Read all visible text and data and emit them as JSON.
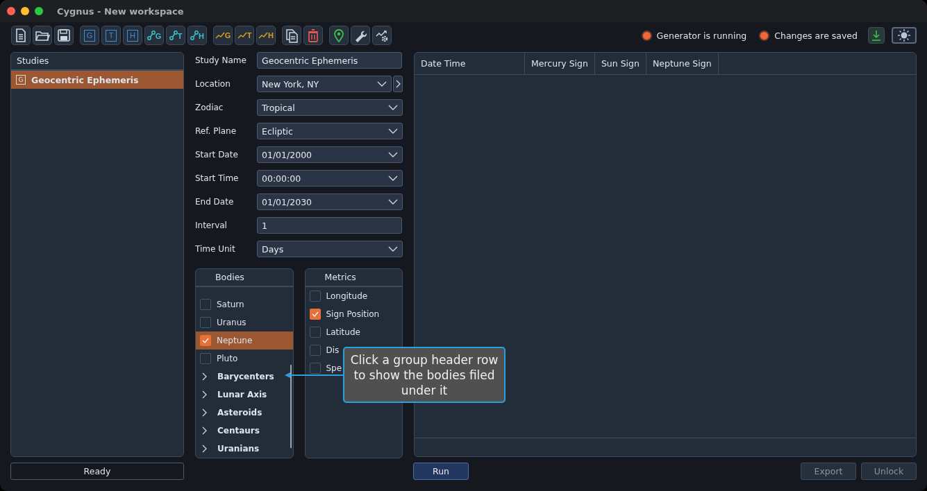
{
  "window": {
    "title": "Cygnus - New workspace"
  },
  "toolbar": [
    [
      {
        "kind": "new"
      },
      {
        "kind": "open"
      },
      {
        "kind": "save"
      }
    ],
    [
      {
        "kind": "boxed",
        "letter": "G"
      },
      {
        "kind": "boxed",
        "letter": "T"
      },
      {
        "kind": "boxed",
        "letter": "H"
      },
      {
        "kind": "nodes",
        "letter": "G"
      },
      {
        "kind": "nodes",
        "letter": "T"
      },
      {
        "kind": "nodes",
        "letter": "H"
      }
    ],
    [
      {
        "kind": "trend",
        "letter": "G"
      },
      {
        "kind": "trend",
        "letter": "T"
      },
      {
        "kind": "trend",
        "letter": "H"
      }
    ],
    [
      {
        "kind": "copy"
      },
      {
        "kind": "delete"
      }
    ],
    [
      {
        "kind": "pin"
      },
      {
        "kind": "wrench"
      },
      {
        "kind": "trend-gear"
      }
    ]
  ],
  "theme_button": {
    "on": true
  },
  "indicators": [
    {
      "label": "Generator is running",
      "on": true
    },
    {
      "label": "Changes are saved",
      "on": true
    }
  ],
  "studies": {
    "title": "Studies",
    "items": [
      {
        "badge": "G",
        "label": "Geocentric Ephemeris",
        "selected": true
      }
    ]
  },
  "form": [
    {
      "label": "Study Name",
      "kind": "text",
      "value": "Geocentric Ephemeris"
    },
    {
      "label": "Location",
      "kind": "dropdown",
      "value": "New York, NY",
      "extra": true
    },
    {
      "label": "Zodiac",
      "kind": "dropdown",
      "value": "Tropical"
    },
    {
      "label": "Ref. Plane",
      "kind": "dropdown",
      "value": "Ecliptic"
    },
    {
      "label": "Start Date",
      "kind": "dropdown",
      "value": "01/01/2000"
    },
    {
      "label": "Start Time",
      "kind": "dropdown",
      "value": "00:00:00"
    },
    {
      "label": "End Date",
      "kind": "dropdown",
      "value": "01/01/2030"
    },
    {
      "label": "Interval",
      "kind": "text",
      "value": "1"
    },
    {
      "label": "Time Unit",
      "kind": "dropdown",
      "value": "Days"
    }
  ],
  "bodies": {
    "title": "Bodies",
    "items": [
      {
        "kind": "body",
        "label": "Saturn",
        "checked": false,
        "selected": false
      },
      {
        "kind": "body",
        "label": "Uranus",
        "checked": false,
        "selected": false
      },
      {
        "kind": "body",
        "label": "Neptune",
        "checked": true,
        "selected": true
      },
      {
        "kind": "body",
        "label": "Pluto",
        "checked": false,
        "selected": false
      },
      {
        "kind": "group",
        "label": "Barycenters",
        "expanded": false
      },
      {
        "kind": "group",
        "label": "Lunar Axis",
        "expanded": false
      },
      {
        "kind": "group",
        "label": "Asteroids",
        "expanded": false
      },
      {
        "kind": "group",
        "label": "Centaurs",
        "expanded": false
      },
      {
        "kind": "group",
        "label": "Uranians",
        "expanded": false
      }
    ]
  },
  "metrics": {
    "title": "Metrics",
    "items": [
      {
        "label": "Longitude",
        "checked": false
      },
      {
        "label": "Sign Position",
        "checked": true
      },
      {
        "label": "Latitude",
        "checked": false
      },
      {
        "label": "Dis",
        "checked": false
      },
      {
        "label": "Spe",
        "checked": false
      }
    ]
  },
  "tooltip": {
    "text": "Click a group header row to show the bodies filed under it"
  },
  "table": {
    "columns": [
      "Date Time",
      "Mercury Sign",
      "Sun Sign",
      "Neptune Sign"
    ]
  },
  "status_bar": {
    "text": "Ready"
  },
  "buttons": [
    {
      "label": "Run",
      "kind": "primary",
      "disabled": false
    },
    {
      "label": "Export",
      "kind": "plain",
      "disabled": true
    },
    {
      "label": "Unlock",
      "kind": "plain",
      "disabled": true
    }
  ]
}
